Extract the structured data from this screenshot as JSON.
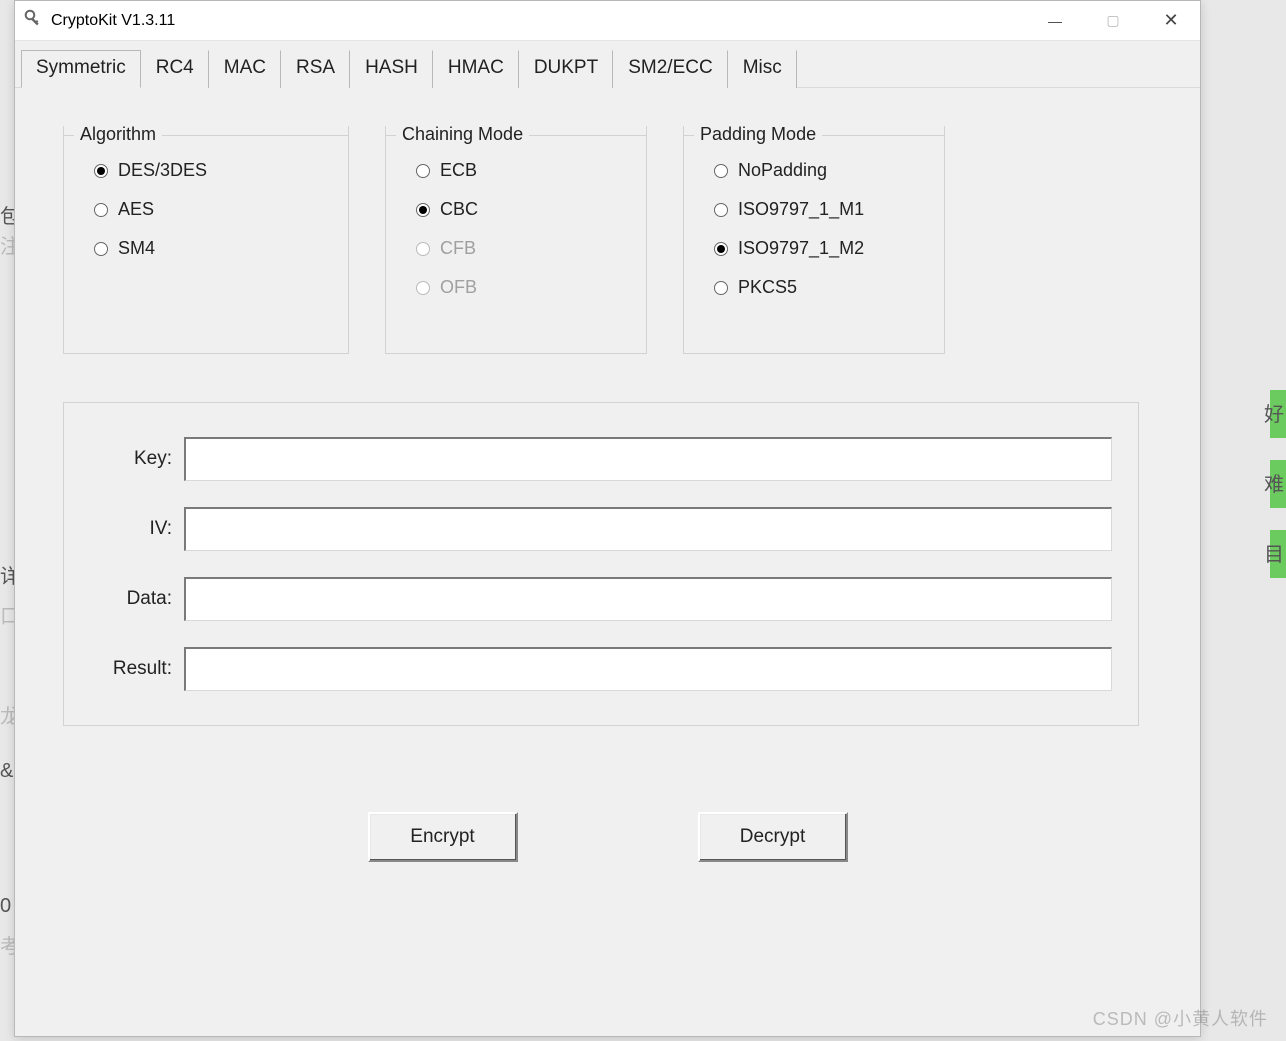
{
  "window": {
    "title": "CryptoKit V1.3.11"
  },
  "tabs": [
    {
      "label": "Symmetric",
      "active": true
    },
    {
      "label": "RC4"
    },
    {
      "label": "MAC"
    },
    {
      "label": "RSA"
    },
    {
      "label": "HASH"
    },
    {
      "label": "HMAC"
    },
    {
      "label": "DUKPT"
    },
    {
      "label": "SM2/ECC"
    },
    {
      "label": "Misc"
    }
  ],
  "groups": {
    "algorithm": {
      "title": "Algorithm",
      "options": [
        {
          "label": "DES/3DES",
          "selected": true
        },
        {
          "label": "AES"
        },
        {
          "label": "SM4"
        }
      ]
    },
    "chaining": {
      "title": "Chaining Mode",
      "options": [
        {
          "label": "ECB"
        },
        {
          "label": "CBC",
          "selected": true
        },
        {
          "label": "CFB",
          "disabled": true
        },
        {
          "label": "OFB",
          "disabled": true
        }
      ]
    },
    "padding": {
      "title": "Padding Mode",
      "options": [
        {
          "label": "NoPadding"
        },
        {
          "label": "ISO9797_1_M1"
        },
        {
          "label": "ISO9797_1_M2",
          "selected": true
        },
        {
          "label": "PKCS5"
        }
      ]
    }
  },
  "fields": {
    "key": {
      "label": "Key:",
      "value": ""
    },
    "iv": {
      "label": "IV:",
      "value": ""
    },
    "data": {
      "label": "Data:",
      "value": ""
    },
    "result": {
      "label": "Result:",
      "value": ""
    }
  },
  "buttons": {
    "encrypt": "Encrypt",
    "decrypt": "Decrypt"
  },
  "watermark": "CSDN @小黄人软件",
  "bg_fragments": {
    "a": "包",
    "b": "注",
    "c": "详",
    "d": "口",
    "e": "龙",
    "f": "&",
    "g": "0",
    "h": "考",
    "i": "好",
    "j": "难",
    "k": "目"
  }
}
